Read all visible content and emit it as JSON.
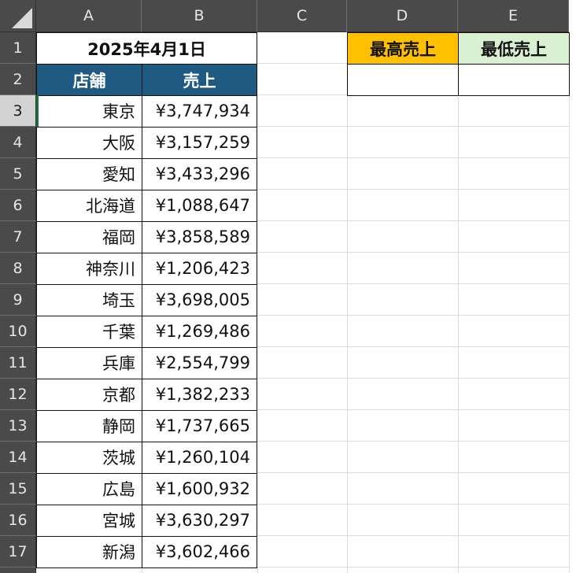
{
  "columns": [
    "A",
    "B",
    "C",
    "D",
    "E"
  ],
  "rows": [
    "1",
    "2",
    "3",
    "4",
    "5",
    "6",
    "7",
    "8",
    "9",
    "10",
    "11",
    "12",
    "13",
    "14",
    "15",
    "16",
    "17"
  ],
  "title": "2025年4月1日",
  "headers": {
    "store": "店舗",
    "sales": "売上"
  },
  "records": [
    {
      "store": "東京",
      "sales": "¥3,747,934"
    },
    {
      "store": "大阪",
      "sales": "¥3,157,259"
    },
    {
      "store": "愛知",
      "sales": "¥3,433,296"
    },
    {
      "store": "北海道",
      "sales": "¥1,088,647"
    },
    {
      "store": "福岡",
      "sales": "¥3,858,589"
    },
    {
      "store": "神奈川",
      "sales": "¥1,206,423"
    },
    {
      "store": "埼玉",
      "sales": "¥3,698,005"
    },
    {
      "store": "千葉",
      "sales": "¥1,269,486"
    },
    {
      "store": "兵庫",
      "sales": "¥2,554,799"
    },
    {
      "store": "京都",
      "sales": "¥1,382,233"
    },
    {
      "store": "静岡",
      "sales": "¥1,737,665"
    },
    {
      "store": "茨城",
      "sales": "¥1,260,104"
    },
    {
      "store": "広島",
      "sales": "¥1,600,932"
    },
    {
      "store": "宮城",
      "sales": "¥3,630,297"
    },
    {
      "store": "新潟",
      "sales": "¥3,602,466"
    }
  ],
  "summary": {
    "max_label": "最高売上",
    "min_label": "最低売上",
    "max_value": "",
    "min_value": ""
  },
  "colors": {
    "header_fill": "#1f5a82",
    "max_fill": "#ffc000",
    "min_fill": "#d9f0d3",
    "chrome": "#4a4a4a"
  },
  "selection": {
    "active_cell": "A3"
  }
}
